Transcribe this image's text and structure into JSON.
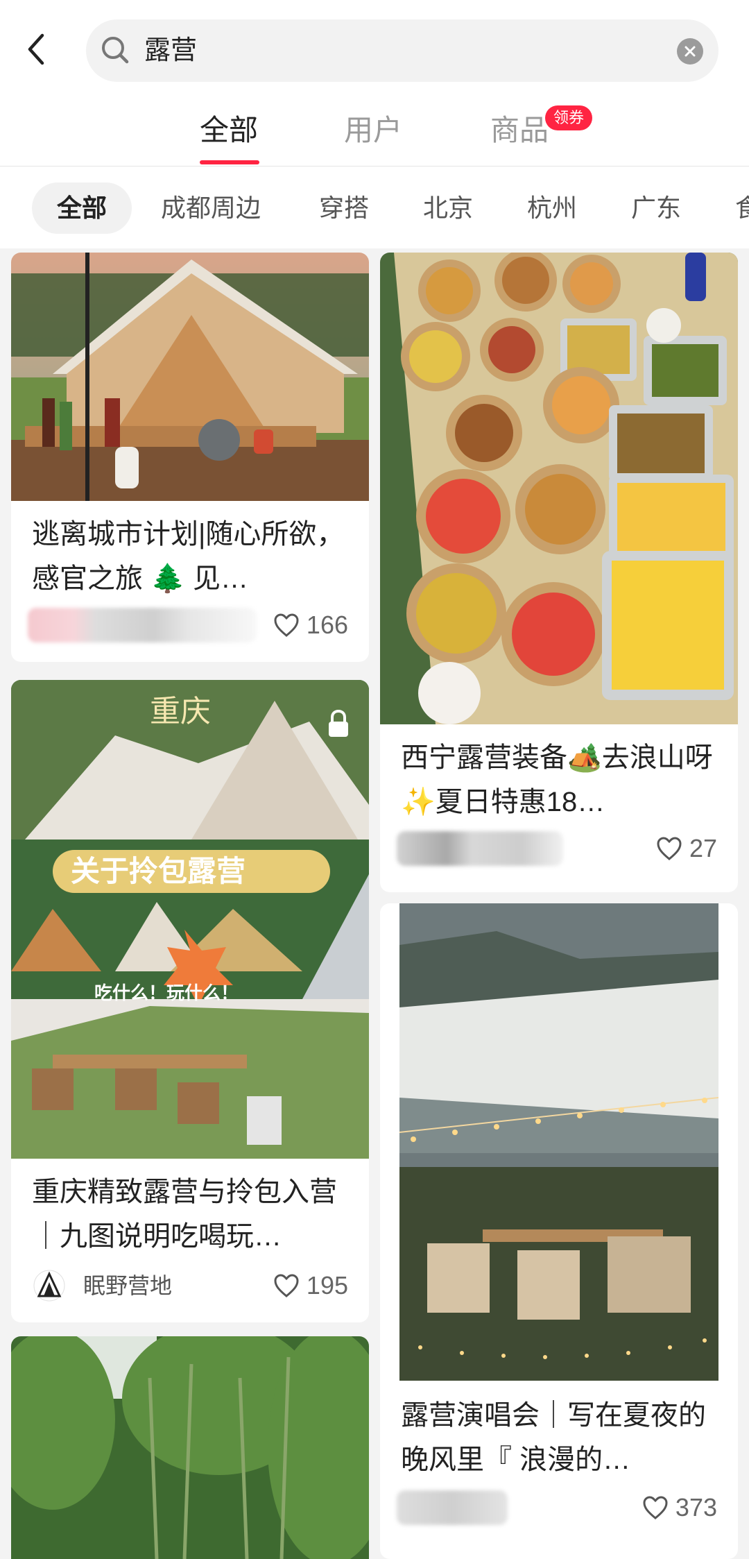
{
  "search": {
    "query": "露营"
  },
  "tabs": [
    {
      "label": "全部",
      "active": true
    },
    {
      "label": "用户",
      "active": false
    },
    {
      "label": "商品",
      "active": false
    }
  ],
  "coupon_badge": "领券",
  "chips": [
    {
      "label": "全部",
      "active": true
    },
    {
      "label": "成都周边",
      "active": false
    },
    {
      "label": "穿搭",
      "active": false
    },
    {
      "label": "北京",
      "active": false
    },
    {
      "label": "杭州",
      "active": false
    },
    {
      "label": "广东",
      "active": false
    },
    {
      "label": "食",
      "active": false
    }
  ],
  "cards": [
    {
      "title": "逃离城市计划|随心所欲，感官之旅 🌲 见…",
      "likes": "166",
      "image": "tent-at-sunset"
    },
    {
      "title": "西宁露营装备🏕️去浪山呀✨夏日特惠18…",
      "likes": "27",
      "image": "picnic-food-spread"
    },
    {
      "title": "重庆精致露营与拎包入营｜九图说明吃喝玩…",
      "author": "眠野营地",
      "likes": "195",
      "image": "camping-collage",
      "overlay": {
        "city": "重庆",
        "banner": "关于拎包露营",
        "badge": "吃什么！玩什么！"
      }
    },
    {
      "title": "露营演唱会｜写在夏夜的晚风里『 浪漫的…",
      "likes": "373",
      "image": "canopy-evening-lights"
    },
    {
      "image": "bamboo-forest"
    }
  ],
  "colors": {
    "accent": "#ff2442",
    "background": "#f3f3f3"
  }
}
